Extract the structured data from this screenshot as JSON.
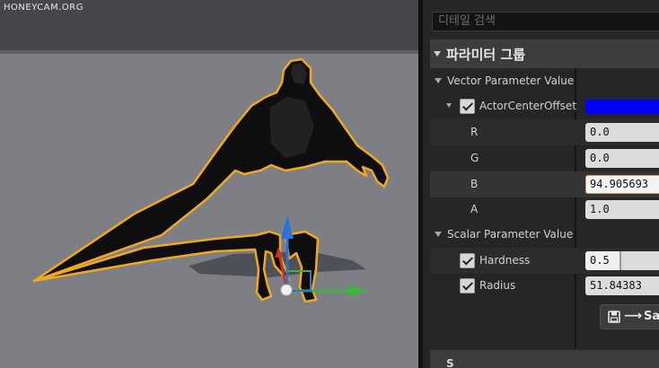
{
  "watermark": "HONEYCAM.ORG",
  "details": {
    "search_placeholder": "디테일 검색",
    "category_title": "파라미터 그룹",
    "vector_group": {
      "label": "Vector Parameter Value",
      "param": {
        "name": "ActorCenterOffset",
        "checked": true,
        "color": "#0000ff",
        "channels": [
          {
            "label": "R",
            "value": "0.0"
          },
          {
            "label": "G",
            "value": "0.0"
          },
          {
            "label": "B",
            "value": "94.905693"
          },
          {
            "label": "A",
            "value": "1.0"
          }
        ]
      }
    },
    "scalar_group": {
      "label": "Scalar Parameter Value",
      "params": [
        {
          "label": "Hardness",
          "checked": true,
          "value": "0.5",
          "slider_fraction": 0.5
        },
        {
          "label": "Radius",
          "checked": true,
          "value": "51.84383"
        }
      ]
    },
    "save_button": {
      "icon": "save-icon",
      "arrow": "⟶",
      "label": "Sa"
    },
    "bottom_category_label": "S"
  },
  "colors": {
    "selection_outline": "#f0a81c",
    "gizmo_x": "#3eb33e",
    "gizmo_z": "#2b73d6",
    "gizmo_y": "#c0392b"
  }
}
